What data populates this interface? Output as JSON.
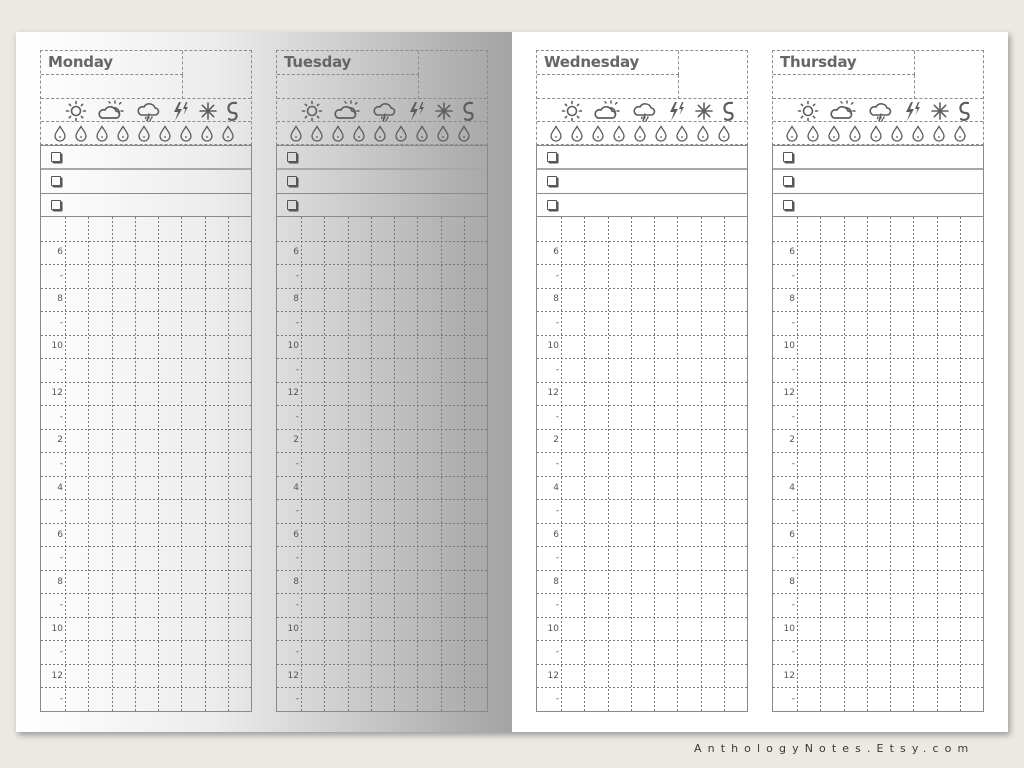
{
  "planner": {
    "days": [
      {
        "name": "Monday"
      },
      {
        "name": "Tuesday"
      },
      {
        "name": "Wednesday"
      },
      {
        "name": "Thursday"
      }
    ],
    "weather_icons": [
      "sun-icon",
      "partly-cloudy-icon",
      "rain-cloud-icon",
      "lightning-icon",
      "snowflake-icon",
      "wind-swirl-icon"
    ],
    "water_drop_count": 9,
    "checkbox_rows": 3,
    "hour_labels": [
      "",
      "6",
      "-",
      "8",
      "-",
      "10",
      "-",
      "12",
      "-",
      "2",
      "-",
      "4",
      "-",
      "6",
      "-",
      "8",
      "-",
      "10",
      "-",
      "12",
      "-"
    ],
    "grid_columns": 8
  },
  "footer": {
    "text": "AnthologyNotes.Etsy.com"
  }
}
